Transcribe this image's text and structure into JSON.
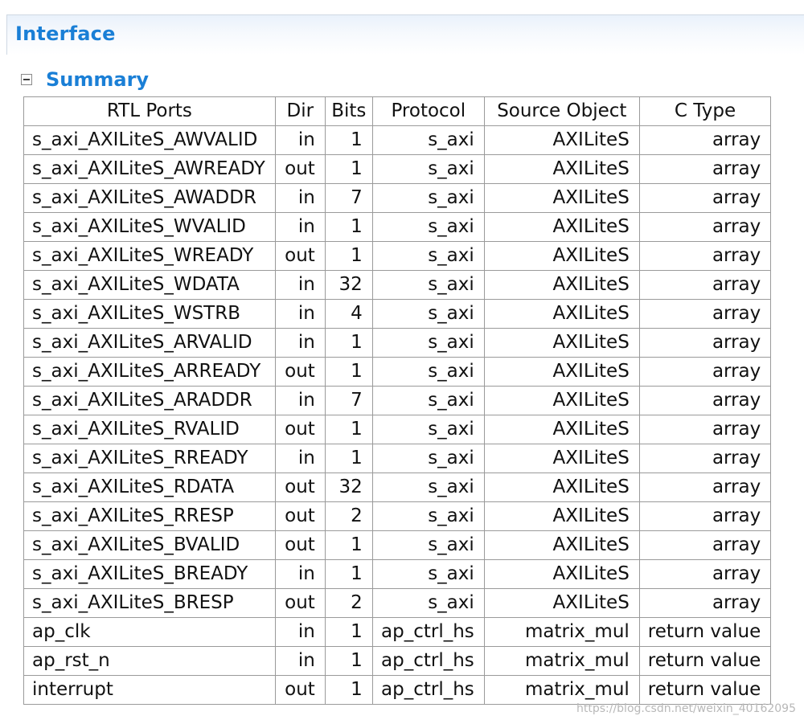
{
  "header": {
    "title": "Interface"
  },
  "summary": {
    "title": "Summary"
  },
  "table": {
    "columns": [
      "RTL Ports",
      "Dir",
      "Bits",
      "Protocol",
      "Source Object",
      "C Type"
    ],
    "rows": [
      [
        "s_axi_AXILiteS_AWVALID",
        "in",
        "1",
        "s_axi",
        "AXILiteS",
        "array"
      ],
      [
        "s_axi_AXILiteS_AWREADY",
        "out",
        "1",
        "s_axi",
        "AXILiteS",
        "array"
      ],
      [
        "s_axi_AXILiteS_AWADDR",
        "in",
        "7",
        "s_axi",
        "AXILiteS",
        "array"
      ],
      [
        "s_axi_AXILiteS_WVALID",
        "in",
        "1",
        "s_axi",
        "AXILiteS",
        "array"
      ],
      [
        "s_axi_AXILiteS_WREADY",
        "out",
        "1",
        "s_axi",
        "AXILiteS",
        "array"
      ],
      [
        "s_axi_AXILiteS_WDATA",
        "in",
        "32",
        "s_axi",
        "AXILiteS",
        "array"
      ],
      [
        "s_axi_AXILiteS_WSTRB",
        "in",
        "4",
        "s_axi",
        "AXILiteS",
        "array"
      ],
      [
        "s_axi_AXILiteS_ARVALID",
        "in",
        "1",
        "s_axi",
        "AXILiteS",
        "array"
      ],
      [
        "s_axi_AXILiteS_ARREADY",
        "out",
        "1",
        "s_axi",
        "AXILiteS",
        "array"
      ],
      [
        "s_axi_AXILiteS_ARADDR",
        "in",
        "7",
        "s_axi",
        "AXILiteS",
        "array"
      ],
      [
        "s_axi_AXILiteS_RVALID",
        "out",
        "1",
        "s_axi",
        "AXILiteS",
        "array"
      ],
      [
        "s_axi_AXILiteS_RREADY",
        "in",
        "1",
        "s_axi",
        "AXILiteS",
        "array"
      ],
      [
        "s_axi_AXILiteS_RDATA",
        "out",
        "32",
        "s_axi",
        "AXILiteS",
        "array"
      ],
      [
        "s_axi_AXILiteS_RRESP",
        "out",
        "2",
        "s_axi",
        "AXILiteS",
        "array"
      ],
      [
        "s_axi_AXILiteS_BVALID",
        "out",
        "1",
        "s_axi",
        "AXILiteS",
        "array"
      ],
      [
        "s_axi_AXILiteS_BREADY",
        "in",
        "1",
        "s_axi",
        "AXILiteS",
        "array"
      ],
      [
        "s_axi_AXILiteS_BRESP",
        "out",
        "2",
        "s_axi",
        "AXILiteS",
        "array"
      ],
      [
        "ap_clk",
        "in",
        "1",
        "ap_ctrl_hs",
        "matrix_mul",
        "return value"
      ],
      [
        "ap_rst_n",
        "in",
        "1",
        "ap_ctrl_hs",
        "matrix_mul",
        "return value"
      ],
      [
        "interrupt",
        "out",
        "1",
        "ap_ctrl_hs",
        "matrix_mul",
        "return value"
      ]
    ]
  },
  "watermark": "https://blog.csdn.net/weixin_40162095",
  "colors": {
    "heading": "#1a7fd6",
    "grid": "#9a9a9a"
  }
}
